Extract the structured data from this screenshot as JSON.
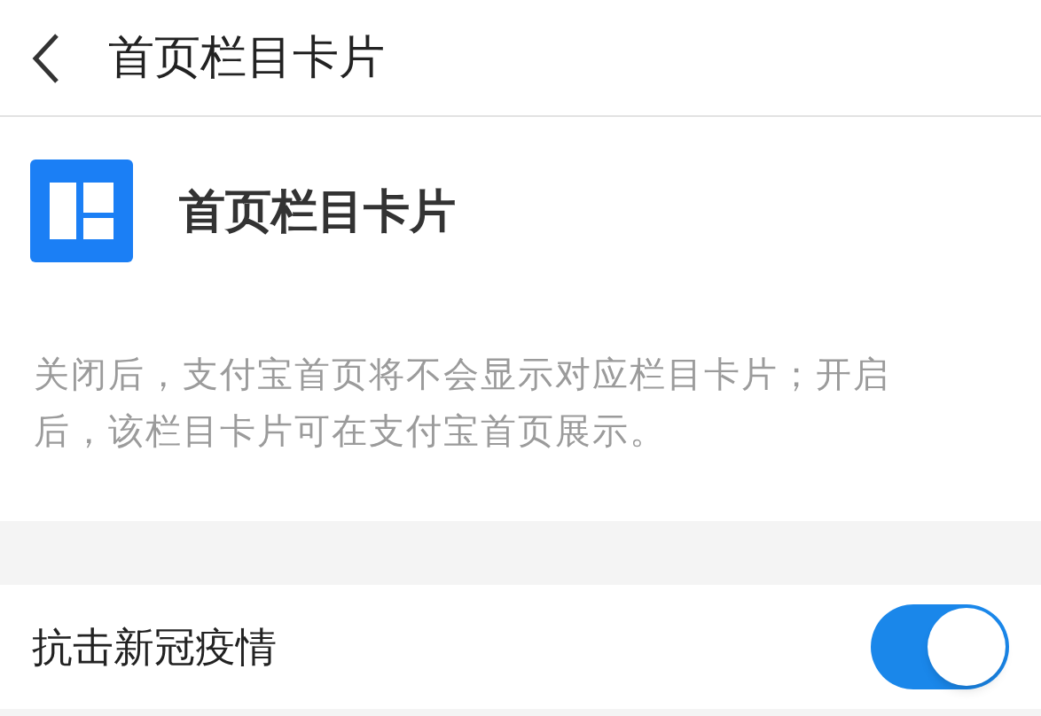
{
  "header": {
    "title": "首页栏目卡片"
  },
  "card": {
    "title": "首页栏目卡片",
    "description": "关闭后，支付宝首页将不会显示对应栏目卡片；开启后，该栏目卡片可在支付宝首页展示。"
  },
  "settings": [
    {
      "label": "抗击新冠疫情",
      "on": true
    }
  ]
}
